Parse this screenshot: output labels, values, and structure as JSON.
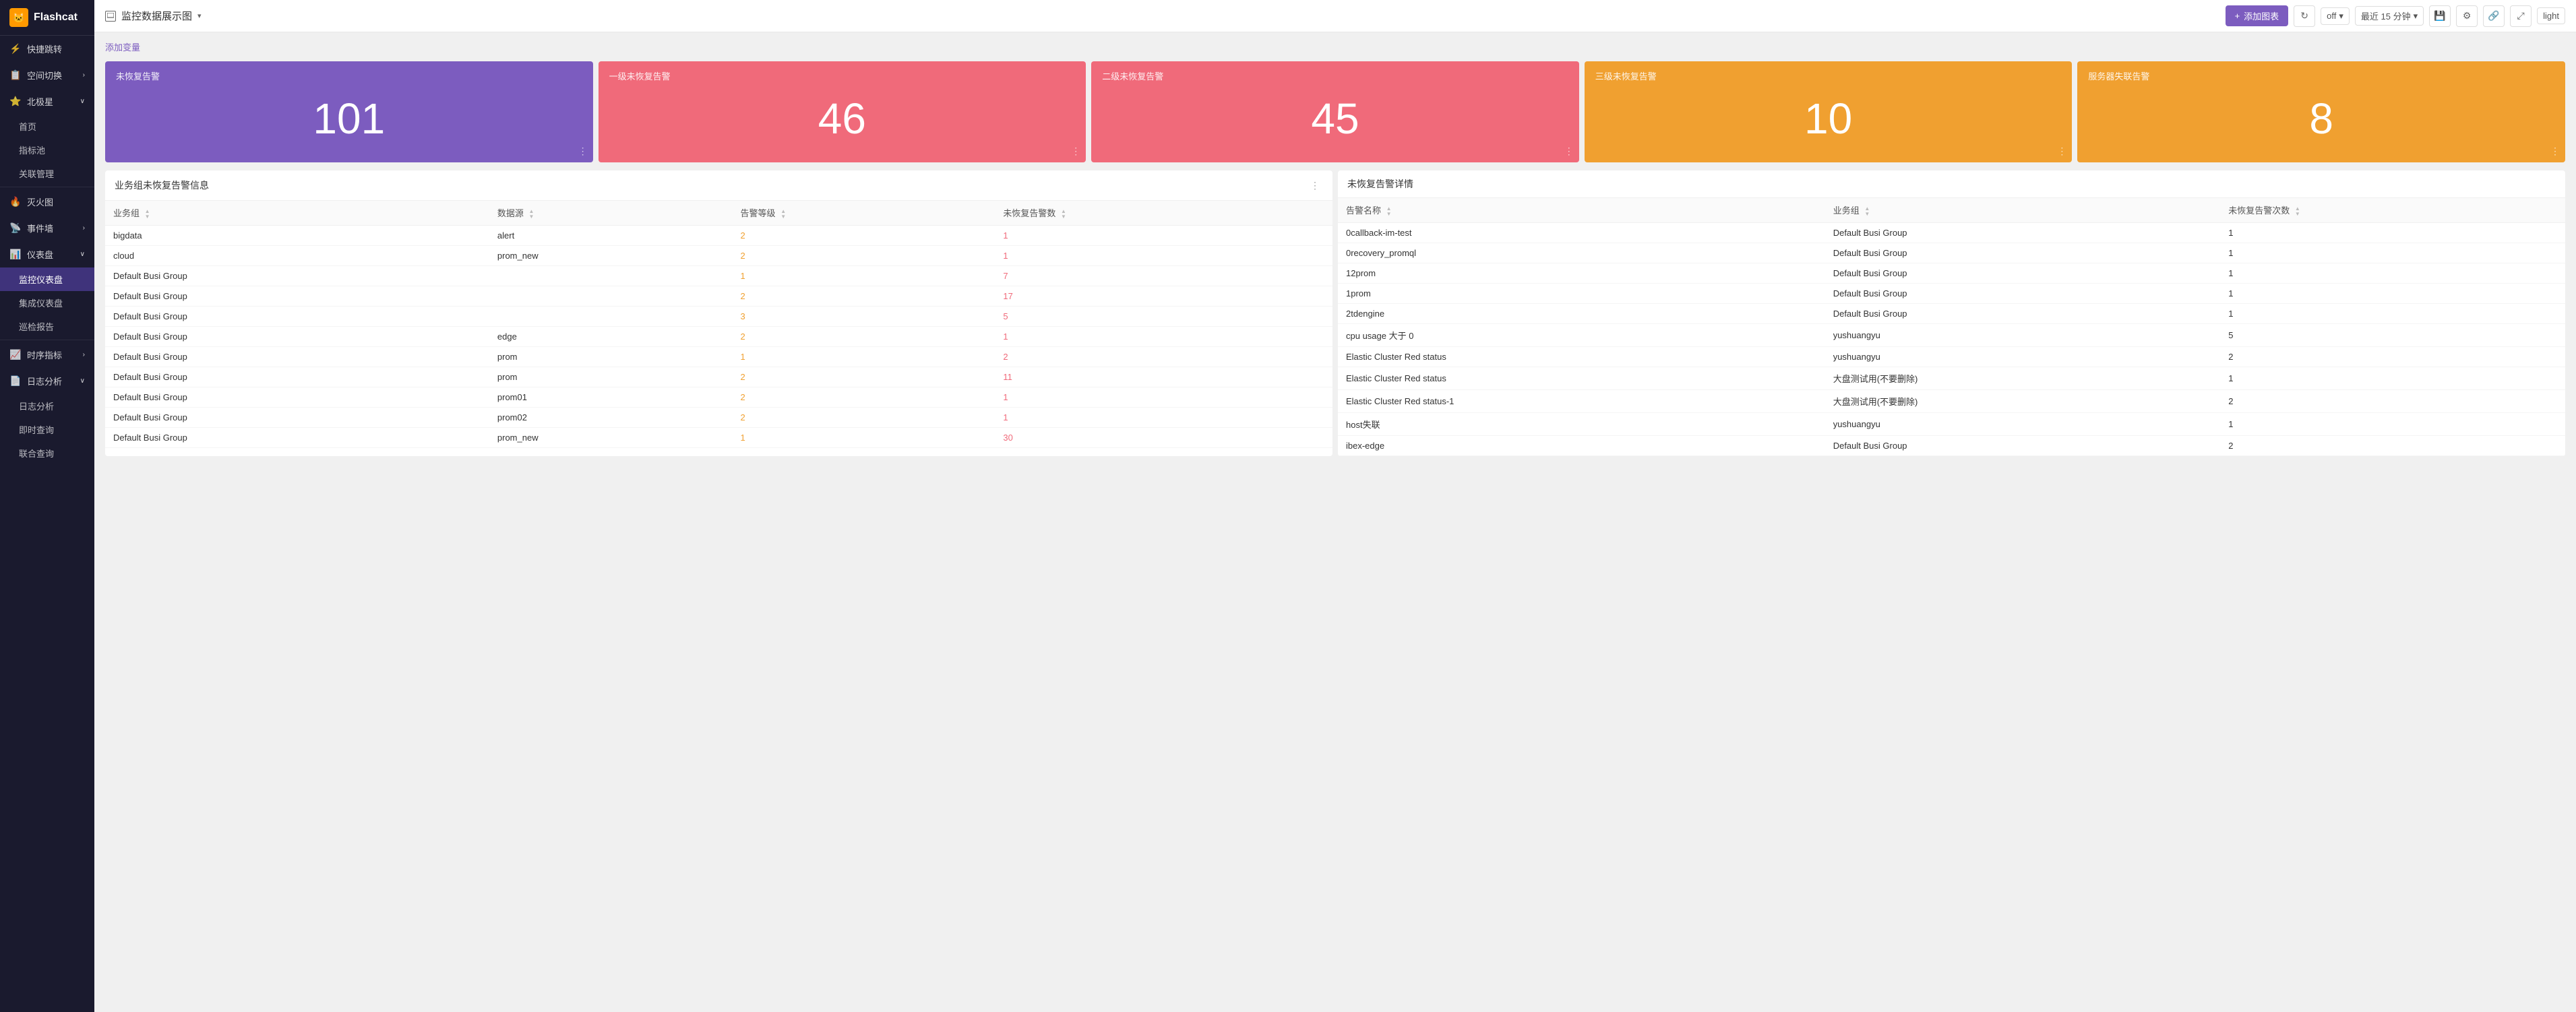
{
  "app": {
    "logo_text": "Flashcat",
    "logo_symbol": "🐱"
  },
  "sidebar": {
    "items": [
      {
        "id": "quick-jump",
        "label": "快捷跳转",
        "icon": "⚡",
        "has_arrow": false
      },
      {
        "id": "space-switch",
        "label": "空间切换",
        "icon": "📋",
        "has_arrow": true
      },
      {
        "id": "north-star",
        "label": "北极星",
        "icon": "⭐",
        "has_arrow": true,
        "expanded": true
      },
      {
        "id": "home",
        "label": "首页",
        "sub": true
      },
      {
        "id": "metrics",
        "label": "指标池",
        "sub": true
      },
      {
        "id": "correlation",
        "label": "关联管理",
        "sub": true
      },
      {
        "id": "fire-map",
        "label": "灭火图",
        "icon": "🔥",
        "has_arrow": false
      },
      {
        "id": "event-wall",
        "label": "事件墙",
        "icon": "📡",
        "has_arrow": true
      },
      {
        "id": "dashboard",
        "label": "仪表盘",
        "icon": "📊",
        "has_arrow": true,
        "expanded": true
      },
      {
        "id": "monitor-dashboard",
        "label": "监控仪表盘",
        "sub": true,
        "active": true
      },
      {
        "id": "integrated-dashboard",
        "label": "集成仪表盘",
        "sub": true
      },
      {
        "id": "patrol-report",
        "label": "巡检报告",
        "sub": true
      },
      {
        "id": "time-metrics",
        "label": "时序指标",
        "icon": "📈",
        "has_arrow": true
      },
      {
        "id": "log-analysis",
        "label": "日志分析",
        "icon": "📄",
        "has_arrow": true,
        "expanded": true
      },
      {
        "id": "log-analysis-sub",
        "label": "日志分析",
        "sub": true
      },
      {
        "id": "instant-query",
        "label": "即时查询",
        "sub": true
      },
      {
        "id": "union-query",
        "label": "联合查询",
        "sub": true
      }
    ]
  },
  "header": {
    "page_icon": "▭",
    "title": "监控数据展示图",
    "chevron": "▾",
    "add_panel_label": "添加图表",
    "add_panel_icon": "+",
    "refresh_icon": "↻",
    "off_label": "off",
    "off_chevron": "▾",
    "time_range": "最近 15 分钟",
    "time_chevron": "▾",
    "save_icon": "💾",
    "settings_icon": "⚙",
    "link_icon": "🔗",
    "fullscreen_icon": "⤢",
    "theme_label": "light"
  },
  "add_variable_link": "添加变量",
  "alert_cards": [
    {
      "id": "unrecovered",
      "title": "未恢复告警",
      "number": "101",
      "color": "purple"
    },
    {
      "id": "level1",
      "title": "一级未恢复告警",
      "number": "46",
      "color": "pink"
    },
    {
      "id": "level2",
      "title": "二级未恢复告警",
      "number": "45",
      "color": "pink"
    },
    {
      "id": "level3",
      "title": "三级未恢复告警",
      "number": "10",
      "color": "orange"
    },
    {
      "id": "server-lost",
      "title": "服务器失联告警",
      "number": "8",
      "color": "orange"
    }
  ],
  "left_table": {
    "title": "业务组未恢复告警信息",
    "menu_icon": "⋮",
    "columns": [
      {
        "id": "biz_group",
        "label": "业务组"
      },
      {
        "id": "data_source",
        "label": "数据源"
      },
      {
        "id": "alert_level",
        "label": "告警等级"
      },
      {
        "id": "unrecovered_count",
        "label": "未恢复告警数"
      }
    ],
    "rows": [
      {
        "biz_group": "bigdata",
        "data_source": "alert",
        "alert_level": "2",
        "alert_level_color": "orange",
        "count": "1",
        "count_color": "red"
      },
      {
        "biz_group": "cloud",
        "data_source": "prom_new",
        "alert_level": "2",
        "alert_level_color": "orange",
        "count": "1",
        "count_color": "red"
      },
      {
        "biz_group": "Default Busi Group",
        "data_source": "",
        "alert_level": "1",
        "alert_level_color": "orange",
        "count": "7",
        "count_color": "red"
      },
      {
        "biz_group": "Default Busi Group",
        "data_source": "",
        "alert_level": "2",
        "alert_level_color": "orange",
        "count": "17",
        "count_color": "red"
      },
      {
        "biz_group": "Default Busi Group",
        "data_source": "",
        "alert_level": "3",
        "alert_level_color": "orange",
        "count": "5",
        "count_color": "red"
      },
      {
        "biz_group": "Default Busi Group",
        "data_source": "edge",
        "alert_level": "2",
        "alert_level_color": "orange",
        "count": "1",
        "count_color": "red"
      },
      {
        "biz_group": "Default Busi Group",
        "data_source": "prom",
        "alert_level": "1",
        "alert_level_color": "orange",
        "count": "2",
        "count_color": "red"
      },
      {
        "biz_group": "Default Busi Group",
        "data_source": "prom",
        "alert_level": "2",
        "alert_level_color": "orange",
        "count": "11",
        "count_color": "red"
      },
      {
        "biz_group": "Default Busi Group",
        "data_source": "prom01",
        "alert_level": "2",
        "alert_level_color": "orange",
        "count": "1",
        "count_color": "red"
      },
      {
        "biz_group": "Default Busi Group",
        "data_source": "prom02",
        "alert_level": "2",
        "alert_level_color": "orange",
        "count": "1",
        "count_color": "red"
      },
      {
        "biz_group": "Default Busi Group",
        "data_source": "prom_new",
        "alert_level": "1",
        "alert_level_color": "orange",
        "count": "30",
        "count_color": "red"
      }
    ]
  },
  "right_table": {
    "title": "未恢复告警详情",
    "columns": [
      {
        "id": "alert_name",
        "label": "告警名称"
      },
      {
        "id": "biz_group",
        "label": "业务组"
      },
      {
        "id": "unrecovered_count",
        "label": "未恢复告警次数"
      }
    ],
    "rows": [
      {
        "alert_name": "0callback-im-test",
        "biz_group": "Default Busi Group",
        "count": "1"
      },
      {
        "alert_name": "0recovery_promql",
        "biz_group": "Default Busi Group",
        "count": "1"
      },
      {
        "alert_name": "12prom",
        "biz_group": "Default Busi Group",
        "count": "1"
      },
      {
        "alert_name": "1prom",
        "biz_group": "Default Busi Group",
        "count": "1"
      },
      {
        "alert_name": "2tdengine",
        "biz_group": "Default Busi Group",
        "count": "1"
      },
      {
        "alert_name": "cpu usage 大于 0",
        "biz_group": "yushuangyu",
        "count": "5"
      },
      {
        "alert_name": "Elastic Cluster Red status",
        "biz_group": "yushuangyu",
        "count": "2"
      },
      {
        "alert_name": "Elastic Cluster Red status",
        "biz_group": "大盘测试用(不要删除)",
        "count": "1"
      },
      {
        "alert_name": "Elastic Cluster Red status-1",
        "biz_group": "大盘测试用(不要删除)",
        "count": "2"
      },
      {
        "alert_name": "host失联",
        "biz_group": "yushuangyu",
        "count": "1"
      },
      {
        "alert_name": "ibex-edge",
        "biz_group": "Default Busi Group",
        "count": "2"
      }
    ]
  }
}
